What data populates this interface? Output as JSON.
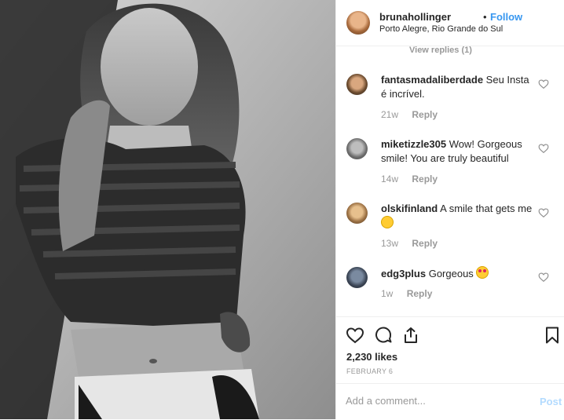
{
  "post": {
    "username": "brunahollinger",
    "separator": "•",
    "follow_label": "Follow",
    "location": "Porto Alegre, Rio Grande do Sul"
  },
  "thread": {
    "view_replies": "View replies (1)"
  },
  "comments": [
    {
      "username": "fantasmadaliberdade",
      "text": "Seu Insta é incrível.",
      "age": "21w",
      "reply": "Reply"
    },
    {
      "username": "miketizzle305",
      "text": "Wow! Gorgeous smile! You are truly beautiful",
      "age": "14w",
      "reply": "Reply"
    },
    {
      "username": "olskifinland",
      "text": "A smile that gets me",
      "age": "13w",
      "reply": "Reply",
      "emoji": "smiling-face-emoji"
    },
    {
      "username": "edg3plus",
      "text": "Gorgeous",
      "age": "1w",
      "reply": "Reply",
      "emoji": "heart-eyes-emoji"
    }
  ],
  "actions": {
    "icons": [
      "heart-icon",
      "comment-icon",
      "share-icon",
      "bookmark-icon"
    ],
    "likes": "2,230 likes",
    "date": "FEBRUARY 6"
  },
  "composer": {
    "placeholder": "Add a comment...",
    "post_label": "Post"
  },
  "colors": {
    "link_blue": "#3897f0",
    "post_disabled": "#b3dbff",
    "muted": "#999999",
    "heart_red": "#e0245e"
  }
}
